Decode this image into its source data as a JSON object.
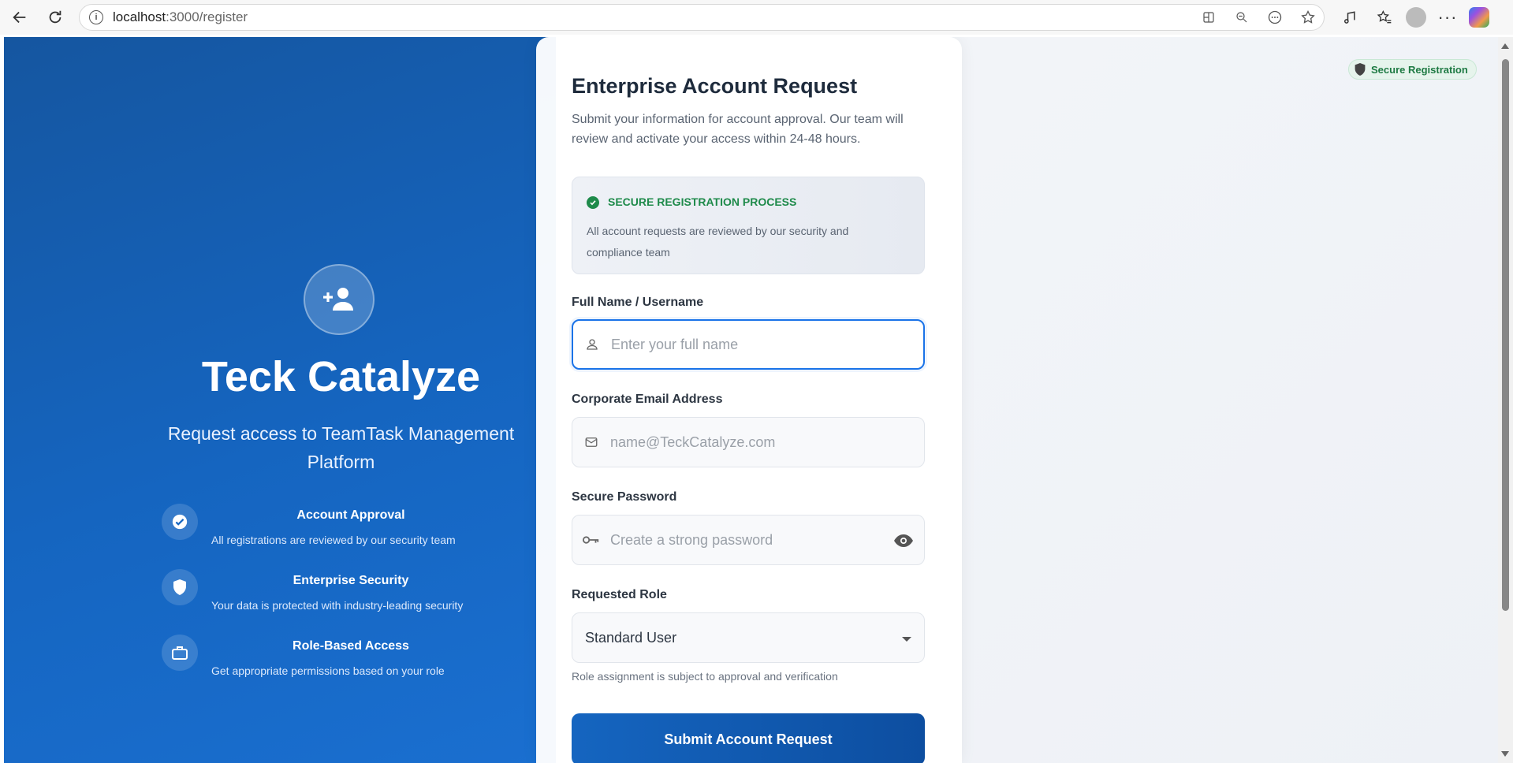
{
  "browser": {
    "url_host": "localhost",
    "url_path": ":3000/register",
    "icons": [
      "back-icon",
      "refresh-icon",
      "info-icon",
      "app-available-icon",
      "zoom-out-icon",
      "read-aloud-icon",
      "favorite-star-icon",
      "music-icon",
      "favorites-icon",
      "profile-icon",
      "more-icon",
      "copilot-icon"
    ]
  },
  "brand": {
    "title": "Teck Catalyze",
    "subtitle": "Request access to TeamTask Management Platform"
  },
  "features": [
    {
      "title": "Account Approval",
      "desc": "All registrations are reviewed by our security team",
      "icon": "check-circle-icon"
    },
    {
      "title": "Enterprise Security",
      "desc": "Your data is protected with industry-leading security",
      "icon": "shield-icon"
    },
    {
      "title": "Role-Based Access",
      "desc": "Get appropriate permissions based on your role",
      "icon": "briefcase-icon"
    }
  ],
  "form": {
    "title": "Enterprise Account Request",
    "description": "Submit your information for account approval. Our team will review and activate your access within 24-48 hours.",
    "notice_title": "SECURE REGISTRATION PROCESS",
    "notice_text": "All account requests are reviewed by our security and compliance team",
    "name_label": "Full Name / Username",
    "name_placeholder": "Enter your full name",
    "email_label": "Corporate Email Address",
    "email_placeholder": "name@TeckCatalyze.com",
    "password_label": "Secure Password",
    "password_placeholder": "Create a strong password",
    "role_label": "Requested Role",
    "role_value": "Standard User",
    "role_hint": "Role assignment is subject to approval and verification",
    "submit_label": "Submit Account Request"
  },
  "badge": {
    "label": "Secure Registration"
  },
  "colors": {
    "primary": "#1565c0",
    "success": "#1e8a4a",
    "focus": "#1a73e8"
  }
}
